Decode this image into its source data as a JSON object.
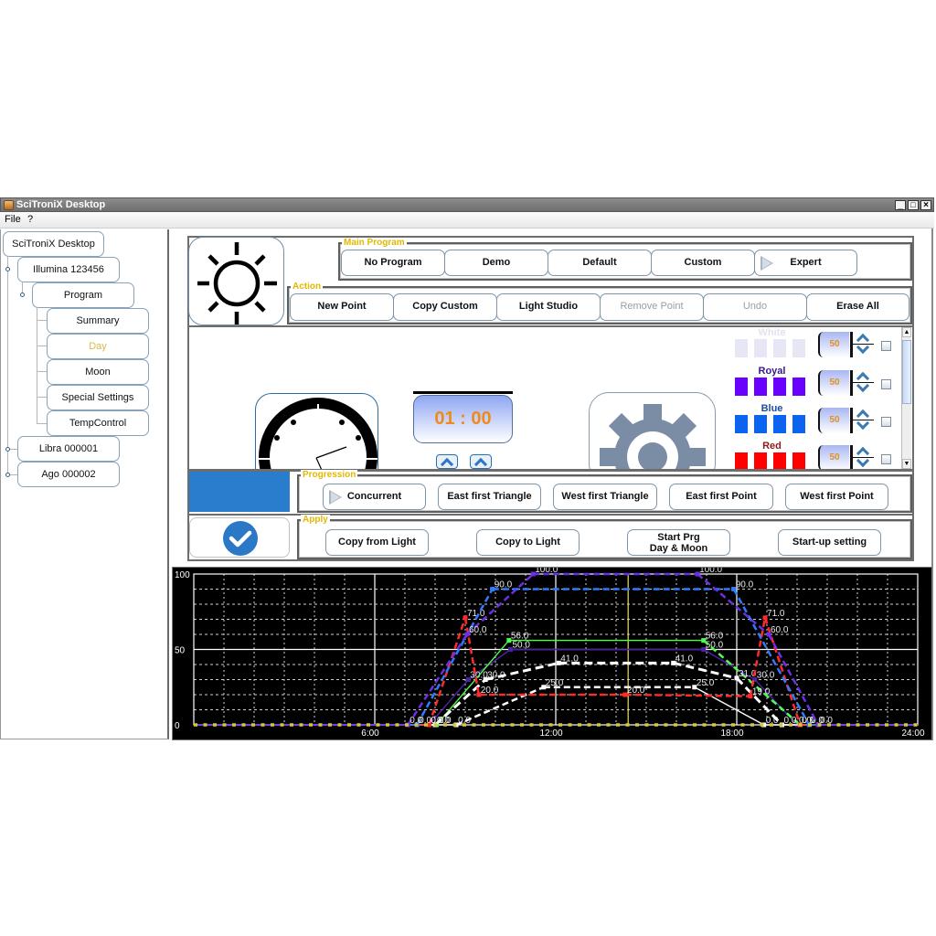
{
  "window": {
    "title": "SciTroniX Desktop",
    "controls": [
      {
        "name": "minimize",
        "glyph": "_"
      },
      {
        "name": "maximize",
        "glyph": "□"
      },
      {
        "name": "close",
        "glyph": "×"
      }
    ]
  },
  "menu": {
    "items": [
      {
        "label": "File"
      },
      {
        "label": "?"
      }
    ]
  },
  "tree": {
    "items": [
      {
        "label": "SciTroniX Desktop",
        "level": 0
      },
      {
        "label": "Illumina 123456",
        "level": 1
      },
      {
        "label": "Program",
        "level": 2
      },
      {
        "label": "Summary",
        "level": 3
      },
      {
        "label": "Day",
        "level": 3,
        "selected": true
      },
      {
        "label": "Moon",
        "level": 3
      },
      {
        "label": "Special Settings",
        "level": 3
      },
      {
        "label": "TempControl",
        "level": 3
      },
      {
        "label": "Libra 000001",
        "level": 1
      },
      {
        "label": "Ago 000002",
        "level": 1
      }
    ]
  },
  "mode_icon": "sun-icon",
  "main_program": {
    "title": "Main Program",
    "buttons": [
      {
        "label": "No Program"
      },
      {
        "label": "Demo"
      },
      {
        "label": "Default"
      },
      {
        "label": "Custom"
      },
      {
        "label": "Expert",
        "icon": "play-triangle-icon",
        "selected": true
      }
    ]
  },
  "action": {
    "title": "Action",
    "buttons": [
      {
        "label": "New Point",
        "enabled": true
      },
      {
        "label": "Copy Custom",
        "enabled": true
      },
      {
        "label": "Light Studio",
        "enabled": true
      },
      {
        "label": "Remove Point",
        "enabled": false
      },
      {
        "label": "Undo",
        "enabled": false
      },
      {
        "label": "Erase All",
        "enabled": true
      }
    ]
  },
  "timer": {
    "value": "01 : 00",
    "color": "#ee8a1c"
  },
  "channels": {
    "items": [
      {
        "name": "White",
        "value": "50",
        "color": "#e6e6f4",
        "label_color": "#e2e2f0",
        "checked": false
      },
      {
        "name": "Royal",
        "value": "50",
        "color": "#6a00ff",
        "label_color": "#3a1a8a",
        "checked": false
      },
      {
        "name": "Blue",
        "value": "50",
        "color": "#0a64f0",
        "label_color": "#1e4e9a",
        "checked": false
      },
      {
        "name": "Red",
        "value": "50",
        "color": "#ff0000",
        "label_color": "#8b1a1a",
        "checked": false
      }
    ]
  },
  "progression": {
    "title": "Progression",
    "indicator_color": "#2a7ccc",
    "buttons": [
      {
        "label": "Concurrent",
        "icon": "play-triangle-icon",
        "selected": true
      },
      {
        "label": "East first Triangle"
      },
      {
        "label": "West first Triangle"
      },
      {
        "label": "East first Point"
      },
      {
        "label": "West first Point"
      }
    ]
  },
  "apply": {
    "title": "Apply",
    "icon": "check-circle-icon",
    "buttons": [
      {
        "label": "Copy from Light"
      },
      {
        "label": "Copy to Light"
      },
      {
        "label": "Start Prg\nDay & Moon"
      },
      {
        "label": "Start-up setting"
      }
    ]
  },
  "chart_data": {
    "type": "line",
    "title": "",
    "xlabel": "",
    "ylabel": "",
    "xlim": [
      0,
      24
    ],
    "ylim": [
      0,
      100
    ],
    "grid": true,
    "x_ticks": [
      {
        "value": 6,
        "label": "6:00"
      },
      {
        "value": 12,
        "label": "12:00"
      },
      {
        "value": 18,
        "label": "18:00"
      },
      {
        "value": 24,
        "label": "24:00"
      }
    ],
    "y_ticks": [
      {
        "value": 0,
        "label": "0"
      },
      {
        "value": 50,
        "label": "50"
      },
      {
        "value": 100,
        "label": "100"
      }
    ],
    "current_time_hour": 14.4,
    "current_time_color": "#e8e070",
    "series": [
      {
        "key": "white-2",
        "color": "#ffffff",
        "points": [
          [
            0,
            0
          ],
          [
            8.7,
            0
          ],
          [
            11.6,
            25
          ],
          [
            16.6,
            25
          ],
          [
            18.9,
            0
          ],
          [
            24,
            0
          ]
        ],
        "dashed": [
          false,
          true,
          true,
          false,
          false
        ]
      },
      {
        "key": "indigo",
        "color": "#4b22a6",
        "points": [
          [
            0,
            0
          ],
          [
            7.8,
            0
          ],
          [
            9.1,
            30
          ],
          [
            10.5,
            50
          ],
          [
            16.9,
            50
          ],
          [
            18.6,
            30
          ],
          [
            20.0,
            0
          ],
          [
            24,
            0
          ]
        ],
        "dashed": [
          false,
          false,
          false,
          false,
          false,
          false,
          false
        ]
      },
      {
        "key": "green",
        "color": "#4cff4c",
        "points": [
          [
            0,
            0
          ],
          [
            8.05,
            0
          ],
          [
            10.45,
            56
          ],
          [
            16.9,
            56
          ],
          [
            20.1,
            0
          ],
          [
            24,
            0
          ]
        ],
        "dashed": [
          false,
          false,
          false,
          true,
          false
        ]
      },
      {
        "key": "white",
        "color": "#ffffff",
        "thick": true,
        "points": [
          [
            0,
            0
          ],
          [
            8.0,
            0
          ],
          [
            9.67,
            30
          ],
          [
            12.1,
            41
          ],
          [
            15.9,
            41
          ],
          [
            18.0,
            31
          ],
          [
            19.5,
            0
          ],
          [
            24,
            0
          ]
        ],
        "dashed": [
          false,
          true,
          true,
          true,
          true,
          true,
          false
        ]
      },
      {
        "key": "red",
        "color": "#ff2a2a",
        "points": [
          [
            0,
            0
          ],
          [
            7.8,
            0
          ],
          [
            9.0,
            71
          ],
          [
            9.45,
            20
          ],
          [
            14.3,
            20
          ],
          [
            18.45,
            19
          ],
          [
            18.94,
            71
          ],
          [
            20.1,
            0
          ],
          [
            24,
            0
          ]
        ],
        "dashed": [
          false,
          true,
          true,
          true,
          true,
          true,
          true,
          false
        ]
      },
      {
        "key": "blue",
        "color": "#2e7bff",
        "points": [
          [
            0,
            0
          ],
          [
            7.4,
            0
          ],
          [
            9.9,
            90
          ],
          [
            17.9,
            90
          ],
          [
            20.4,
            0
          ],
          [
            24,
            0
          ]
        ],
        "dashed": [
          false,
          true,
          true,
          true,
          false
        ]
      },
      {
        "key": "royal",
        "color": "#6b2fe6",
        "points": [
          [
            0,
            0
          ],
          [
            7.1,
            0
          ],
          [
            9.06,
            60
          ],
          [
            11.25,
            100
          ],
          [
            16.7,
            100
          ],
          [
            19.06,
            60
          ],
          [
            20.7,
            0
          ],
          [
            24,
            0
          ]
        ],
        "dashed": [
          false,
          true,
          true,
          true,
          true,
          true,
          false
        ]
      },
      {
        "key": "yellow",
        "color": "#d9c92e",
        "points": [
          [
            0,
            0
          ],
          [
            24,
            0
          ]
        ],
        "dotted": true,
        "no_labels": true
      }
    ]
  }
}
